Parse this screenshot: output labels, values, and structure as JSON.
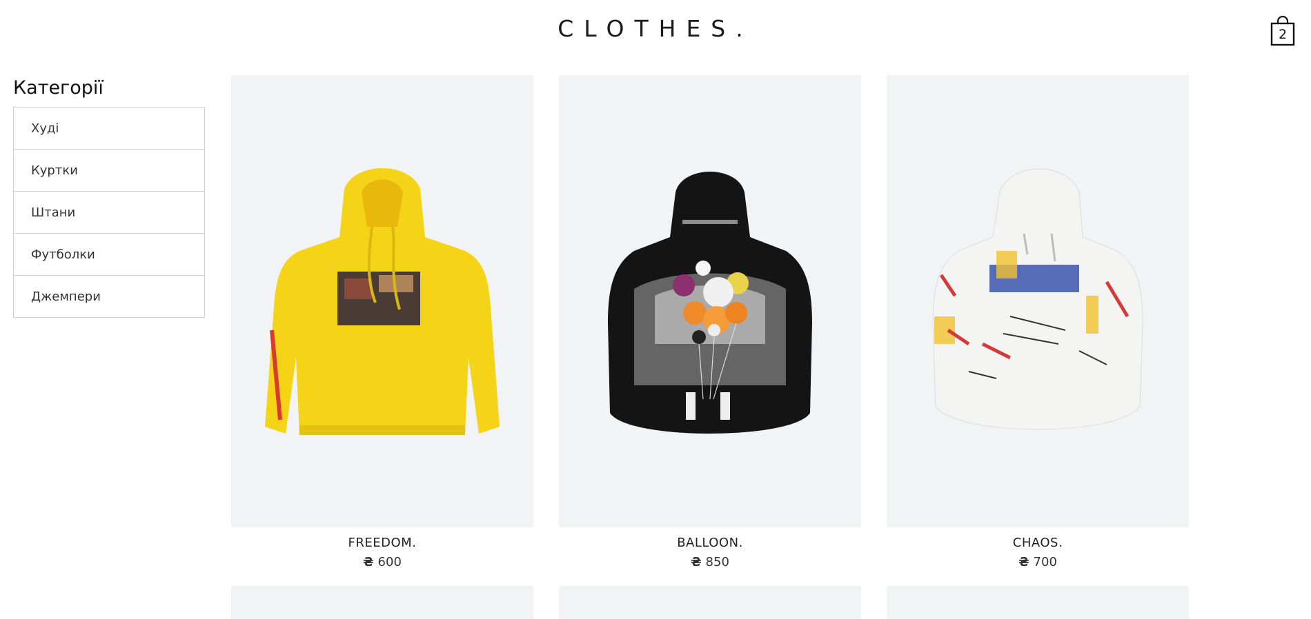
{
  "header": {
    "logo": "CLOTHES.",
    "cart_count": "2",
    "cart_icon": "shopping-bag-icon"
  },
  "sidebar": {
    "title": "Категорії",
    "items": [
      {
        "label": "Худі"
      },
      {
        "label": "Куртки"
      },
      {
        "label": "Штани"
      },
      {
        "label": "Футболки"
      },
      {
        "label": "Джемпери"
      }
    ]
  },
  "products": [
    {
      "name": "FREEDOM.",
      "currency": "₴",
      "price": "600",
      "color": "#f2d31b"
    },
    {
      "name": "BALLOON.",
      "currency": "₴",
      "price": "850",
      "color": "#111111"
    },
    {
      "name": "CHAOS.",
      "currency": "₴",
      "price": "700",
      "color": "#f4f4f2"
    }
  ],
  "colors": {
    "card_background": "#f2f3f5",
    "border": "#cfcfcf"
  }
}
